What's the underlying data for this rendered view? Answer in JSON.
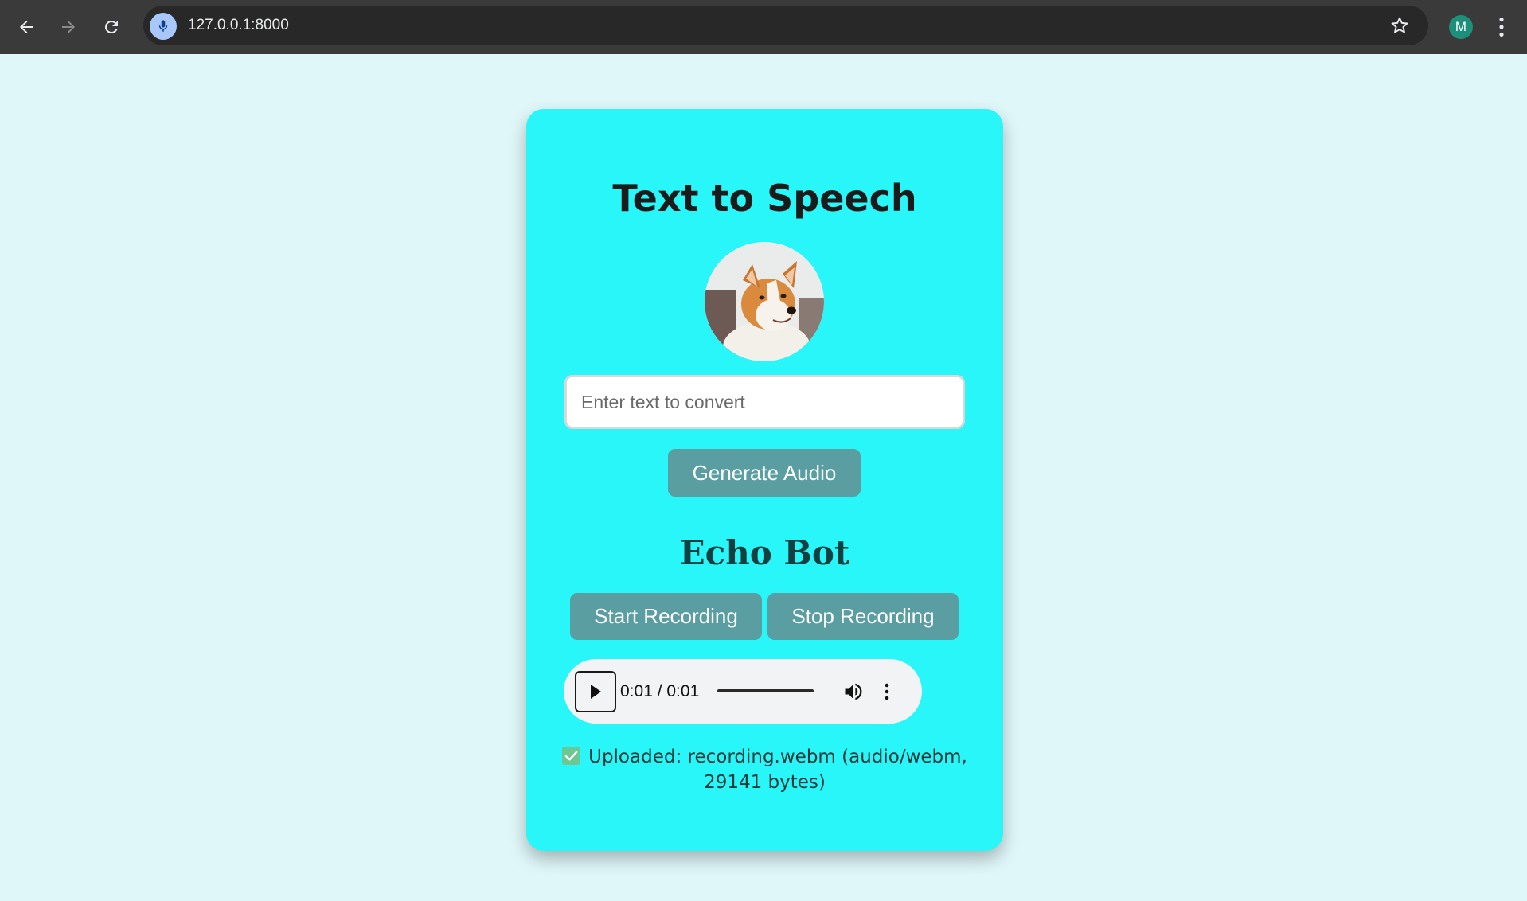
{
  "browser": {
    "url": "127.0.0.1:8000",
    "profile_initial": "M"
  },
  "app": {
    "title": "Text to Speech",
    "input_placeholder": "Enter text to convert",
    "generate_label": "Generate Audio",
    "echo_title": "Echo Bot",
    "start_label": "Start Recording",
    "stop_label": "Stop Recording"
  },
  "player": {
    "time": "0:01 / 0:01",
    "progress": 1.0
  },
  "status": {
    "line1": "Uploaded: recording.webm (audio/webm,",
    "line2": "29141 bytes)"
  },
  "colors": {
    "page_bg": "#dff7f9",
    "card_bg": "#29f6f8",
    "button_bg": "#5a9ea2",
    "check_green": "#6cc793"
  }
}
